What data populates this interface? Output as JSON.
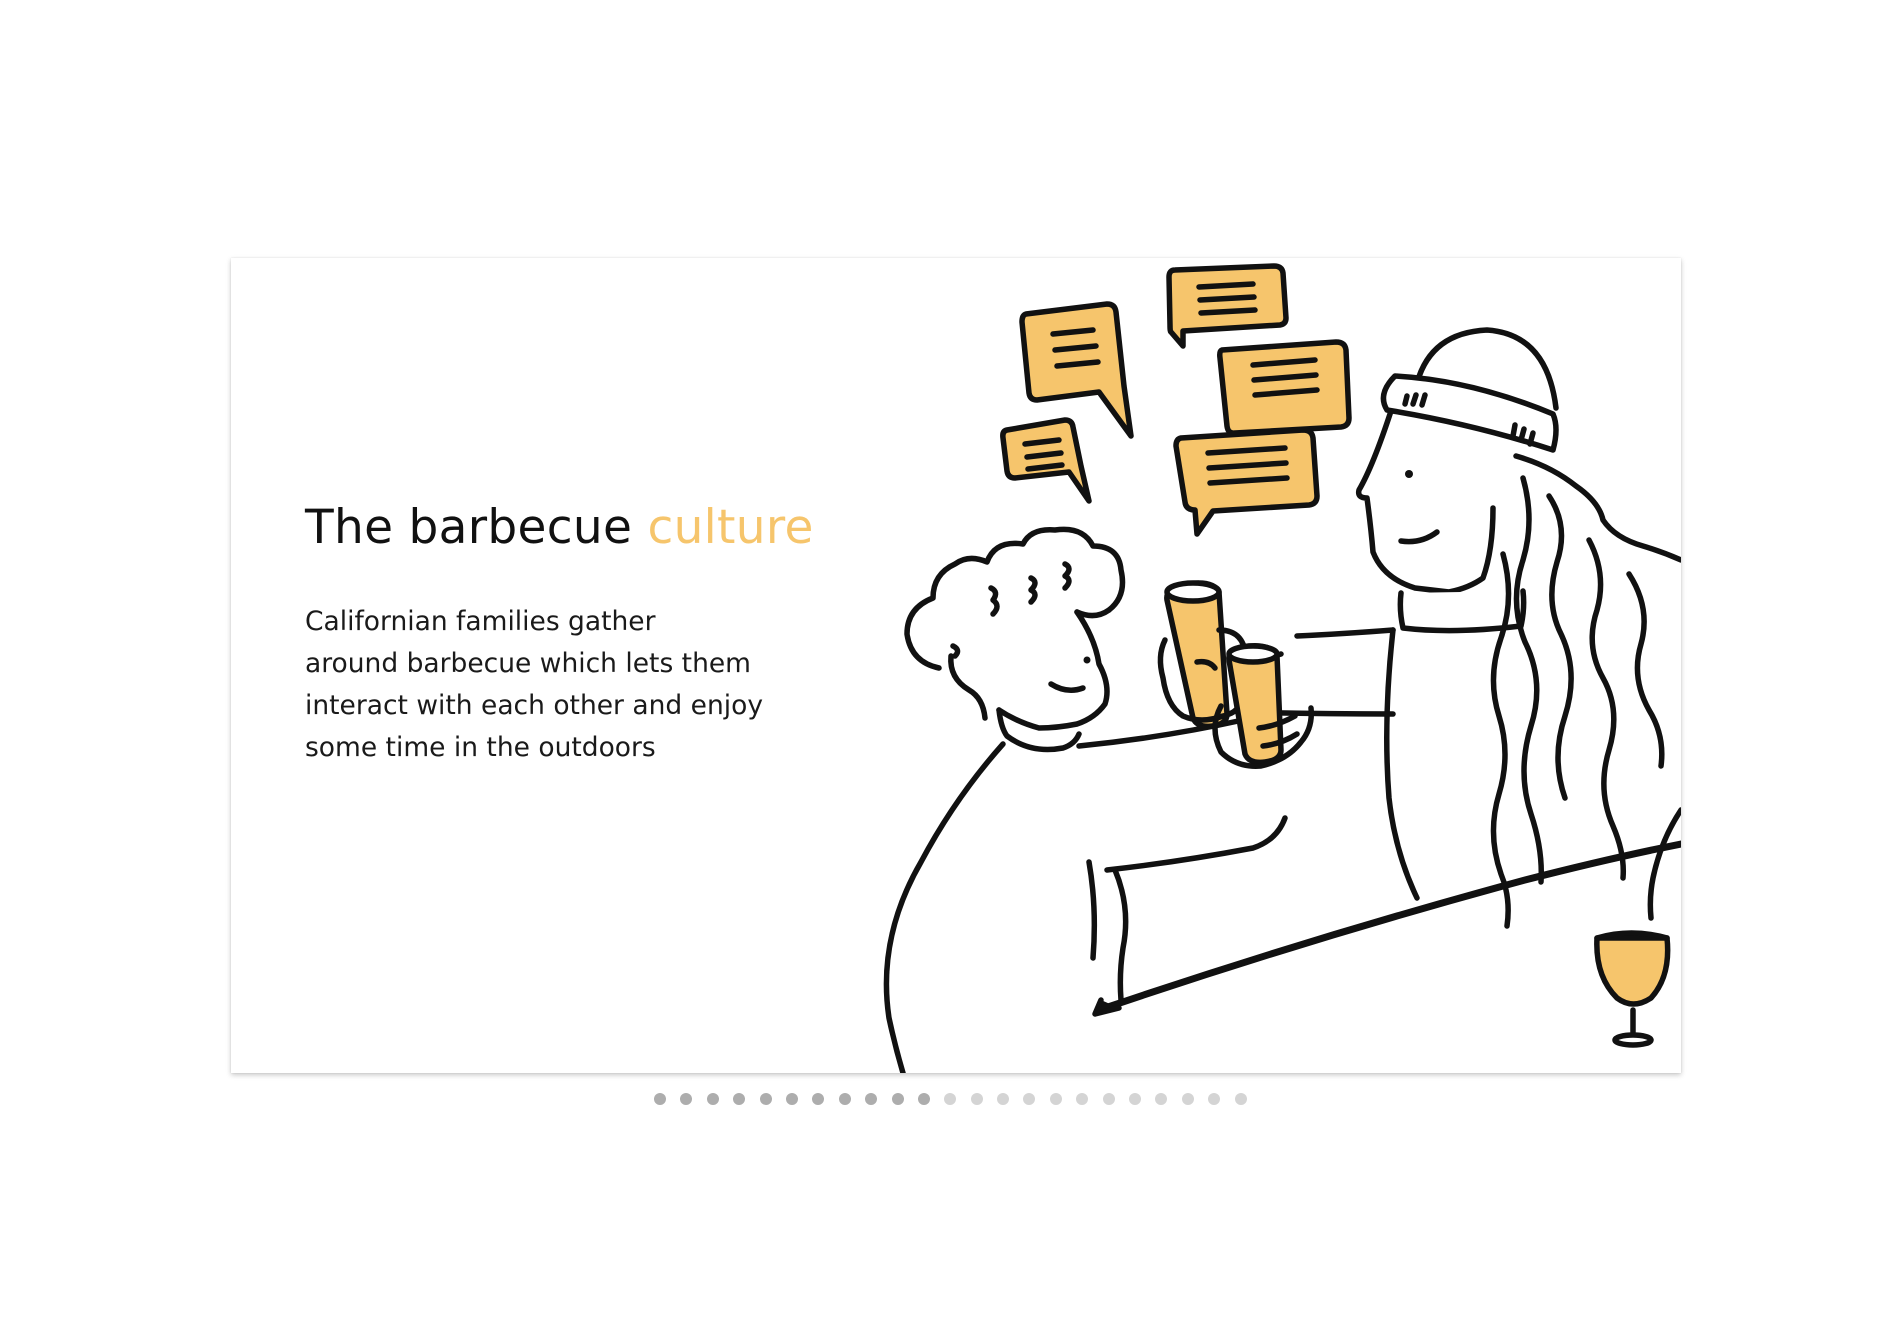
{
  "slide": {
    "title_main": "The barbecue ",
    "title_accent": "culture",
    "body_lines": [
      "Californian families gather",
      "around barbecue which lets them",
      "interact with each other and enjoy",
      "some time in the outdoors"
    ]
  },
  "illustration": {
    "icons": [
      "speech-bubble-icon",
      "wine-glass-icon",
      "cup-icon"
    ]
  },
  "colors": {
    "accent": "#f6c56c",
    "ink": "#111111",
    "dot_active": "#adadad",
    "dot_inactive": "#d4d4d4"
  },
  "pagination": {
    "total": 23,
    "filled": 11
  }
}
